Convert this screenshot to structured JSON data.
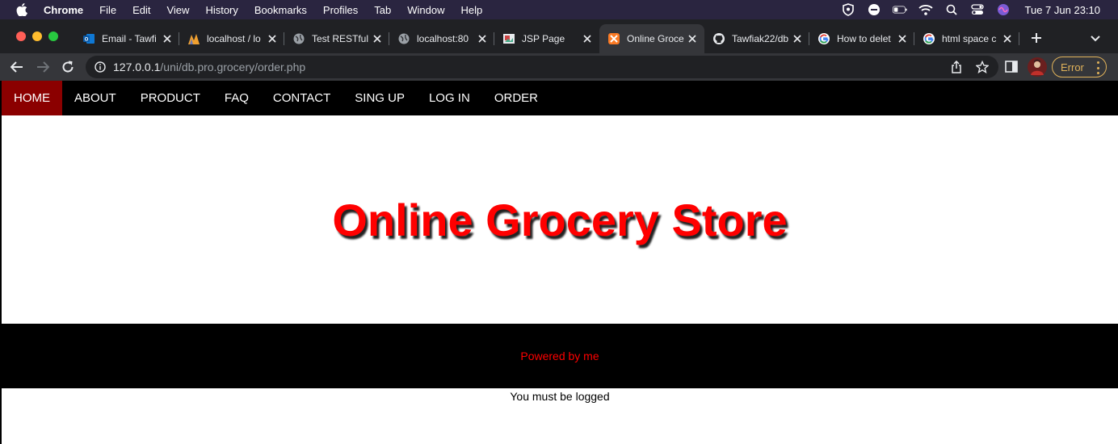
{
  "os_menubar": {
    "app_name": "Chrome",
    "menus": [
      "File",
      "Edit",
      "View",
      "History",
      "Bookmarks",
      "Profiles",
      "Tab",
      "Window",
      "Help"
    ],
    "clock": "Tue 7 Jun  23:10"
  },
  "browser": {
    "tabs": [
      {
        "title": "Email - Tawfi",
        "icon": "outlook-icon",
        "active": false
      },
      {
        "title": "localhost / lo",
        "icon": "phpmyadmin-icon",
        "active": false
      },
      {
        "title": "Test RESTful",
        "icon": "globe-icon",
        "active": false
      },
      {
        "title": "localhost:80",
        "icon": "globe-icon",
        "active": false
      },
      {
        "title": "JSP Page",
        "icon": "page-icon",
        "active": false
      },
      {
        "title": "Online Groce",
        "icon": "xampp-icon",
        "active": true
      },
      {
        "title": "Tawfiak22/db",
        "icon": "github-icon",
        "active": false
      },
      {
        "title": "How to delet",
        "icon": "google-icon",
        "active": false
      },
      {
        "title": "html space c",
        "icon": "google-icon",
        "active": false
      }
    ],
    "url_host": "127.0.0.1",
    "url_path": "/uni/db.pro.grocery/order.php",
    "error_label": "Error",
    "colors": {
      "tabstrip": "#202124",
      "toolbar": "#35363a",
      "error": "#e0b25a"
    }
  },
  "site": {
    "nav": [
      {
        "label": "HOME",
        "active": true
      },
      {
        "label": "ABOUT",
        "active": false
      },
      {
        "label": "PRODUCT",
        "active": false
      },
      {
        "label": "FAQ",
        "active": false
      },
      {
        "label": "CONTACT",
        "active": false
      },
      {
        "label": "SING UP",
        "active": false
      },
      {
        "label": "LOG IN",
        "active": false
      },
      {
        "label": "ORDER",
        "active": false
      }
    ],
    "title": "Online Grocery Store",
    "footer_text": "Powered by me",
    "notice": "You must be logged",
    "colors": {
      "accent": "#ff0000",
      "nav_active": "#8b0000",
      "nav_bg": "#000000"
    }
  }
}
